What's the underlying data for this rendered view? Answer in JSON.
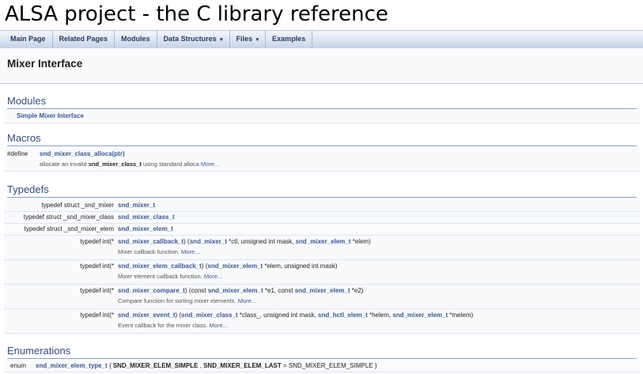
{
  "title": "ALSA project - the C library reference",
  "nav": [
    {
      "label": "Main Page",
      "caret": ""
    },
    {
      "label": "Related Pages",
      "caret": ""
    },
    {
      "label": "Modules",
      "caret": ""
    },
    {
      "label": "Data Structures",
      "caret": "▾"
    },
    {
      "label": "Files",
      "caret": "▾"
    },
    {
      "label": "Examples",
      "caret": ""
    }
  ],
  "header": {
    "title": "Mixer Interface"
  },
  "sections": {
    "modules": "Modules",
    "macros": "Macros",
    "typedefs": "Typedefs",
    "enumerations": "Enumerations"
  },
  "modules": {
    "item": "Simple Mixer Interface"
  },
  "macros": {
    "left": "#define",
    "name": "snd_mixer_class_alloca(ptr)",
    "desc_pre": "allocate an invalid ",
    "desc_type": "snd_mixer_class_t",
    "desc_post": " using standard alloca ",
    "more": "More..."
  },
  "typedefs": {
    "t1_left": "typedef struct _snd_mixer",
    "t1_name": "snd_mixer_t",
    "t2_left": "typedef struct _snd_mixer_class",
    "t2_name": "snd_mixer_class_t",
    "t3_left": "typedef struct _snd_mixer_elem",
    "t3_name": "snd_mixer_elem_t",
    "fp_left": "typedef int(*",
    "cb1": {
      "name": "snd_mixer_callback_t",
      "a": ") (",
      "t1": "snd_mixer_t",
      "a2": " *ctl, unsigned int mask, ",
      "t2": "snd_mixer_elem_t",
      "a3": " *elem)",
      "desc": "Mixer callback function. ",
      "more": "More..."
    },
    "cb2": {
      "name": "snd_mixer_elem_callback_t",
      "a": ") (",
      "t1": "snd_mixer_elem_t",
      "a2": " *elem, unsigned int mask)",
      "desc": "Mixer element callback function. ",
      "more": "More..."
    },
    "cb3": {
      "name": "snd_mixer_compare_t",
      "a": ") (const ",
      "t1": "snd_mixer_elem_t",
      "a2": " *e1, const ",
      "t2": "snd_mixer_elem_t",
      "a3": " *e2)",
      "desc": "Compare function for sorting mixer elements. ",
      "more": "More..."
    },
    "cb4": {
      "name": "snd_mixer_event_t",
      "a": ") (",
      "t1": "snd_mixer_class_t",
      "a2": " *class_, unsigned int mask, ",
      "t2": "snd_hctl_elem_t",
      "a3": " *helem, ",
      "t3": "snd_mixer_elem_t",
      "a4": " *melem)",
      "desc": "Event callback for the mixer class. ",
      "more": "More..."
    }
  },
  "enums": {
    "left": "enum",
    "name": "snd_mixer_elem_type_t",
    "open": " { ",
    "v1": "SND_MIXER_ELEM_SIMPLE",
    "sep": " , ",
    "v2": "SND_MIXER_ELEM_LAST",
    "eq": " = SND_MIXER_ELEM_SIMPLE }"
  }
}
